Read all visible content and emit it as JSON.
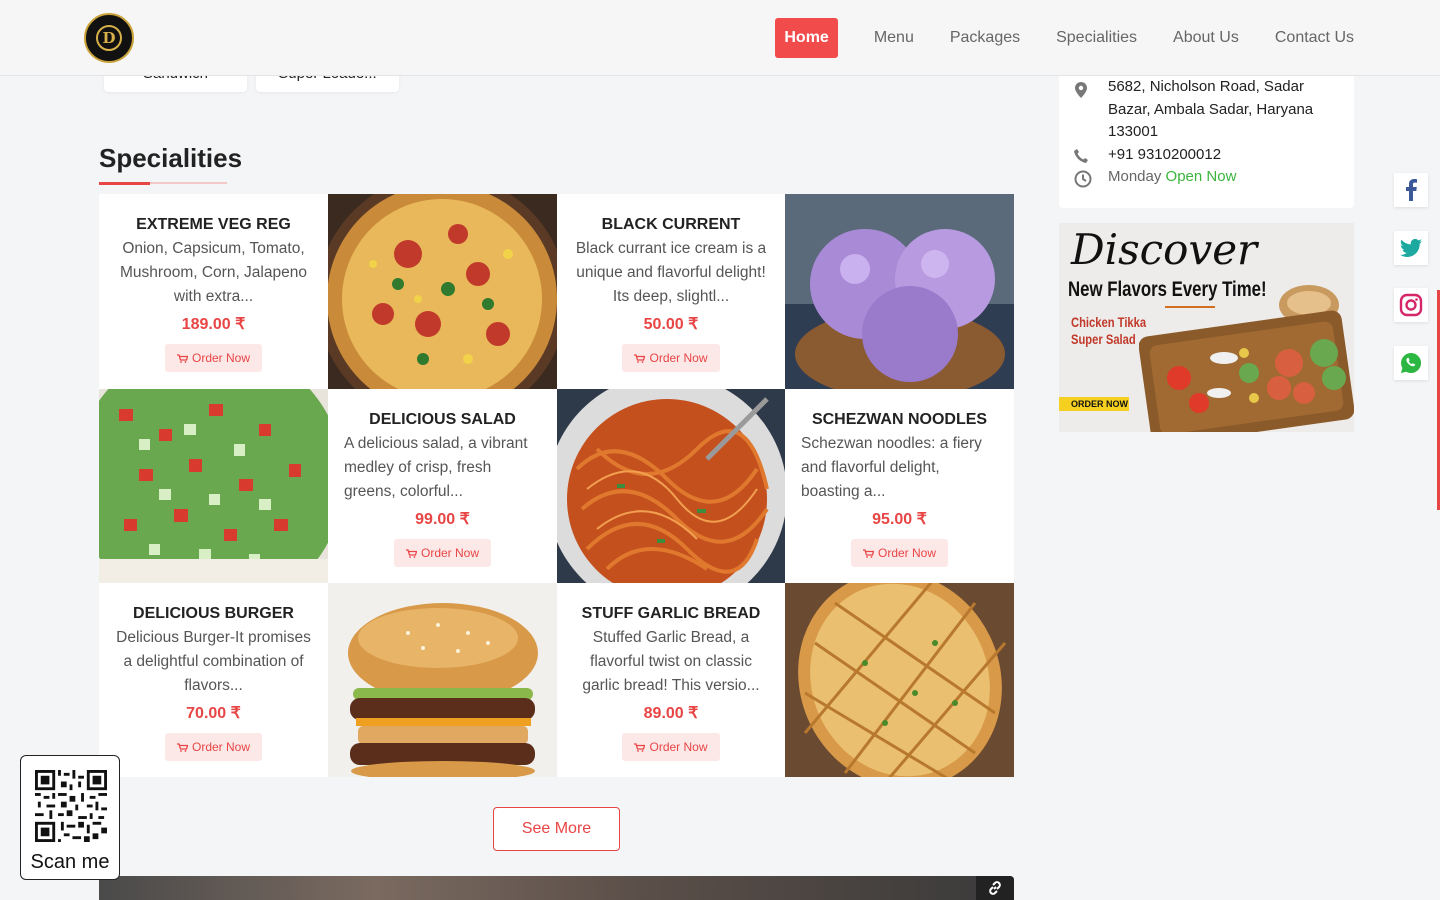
{
  "header": {
    "logo_letter": "D",
    "nav": [
      {
        "label": "Home",
        "active": true
      },
      {
        "label": "Menu"
      },
      {
        "label": "Packages"
      },
      {
        "label": "Specialities"
      },
      {
        "label": "About Us"
      },
      {
        "label": "Contact Us"
      }
    ]
  },
  "category_chips": [
    "Sandwich",
    "Super Loade..."
  ],
  "section": {
    "title": "Specialities"
  },
  "items": [
    {
      "name": "EXTREME VEG REG",
      "desc": "Onion, Capsicum, Tomato, Mushroom, Corn, Jalapeno with extra...",
      "price": "189.00 ₹",
      "order": "Order Now"
    },
    {
      "name": "BLACK CURRENT",
      "desc": "Black currant ice cream is a unique and flavorful delight! Its deep, slightl...",
      "price": "50.00 ₹",
      "order": "Order Now"
    },
    {
      "name": "DELICIOUS SALAD",
      "desc": "A delicious salad, a vibrant medley of crisp, fresh greens, colorful...",
      "price": "99.00 ₹",
      "order": "Order Now"
    },
    {
      "name": "SCHEZWAN NOODLES",
      "desc": "Schezwan noodles: a fiery and flavorful delight, boasting a...",
      "price": "95.00 ₹",
      "order": "Order Now"
    },
    {
      "name": "DELICIOUS BURGER",
      "desc": "Delicious Burger-It promises a delightful combination of flavors...",
      "price": "70.00 ₹",
      "order": "Order Now"
    },
    {
      "name": "STUFF GARLIC BREAD",
      "desc": "Stuffed Garlic Bread, a flavorful twist on classic garlic bread! This versio...",
      "price": "89.00 ₹",
      "order": "Order Now"
    }
  ],
  "see_more": "See More",
  "info": {
    "address": "5682, Nicholson Road, Sadar Bazar, Ambala Sadar, Haryana 133001",
    "phone": "+91 9310200012",
    "day": "Monday",
    "status": "Open Now"
  },
  "promo": {
    "headline": "Discover",
    "subhead": "New Flavors Every Time!",
    "dish_line1": "Chicken Tikka",
    "dish_line2": "Super Salad",
    "cta": "ORDER NOW"
  },
  "qr": {
    "label": "Scan me"
  },
  "colors": {
    "accent": "#e84545",
    "open": "#3cb43c"
  },
  "icons": [
    "facebook-icon",
    "twitter-icon",
    "instagram-icon",
    "whatsapp-icon",
    "location-icon",
    "phone-icon",
    "clock-icon",
    "cart-icon",
    "link-icon"
  ]
}
